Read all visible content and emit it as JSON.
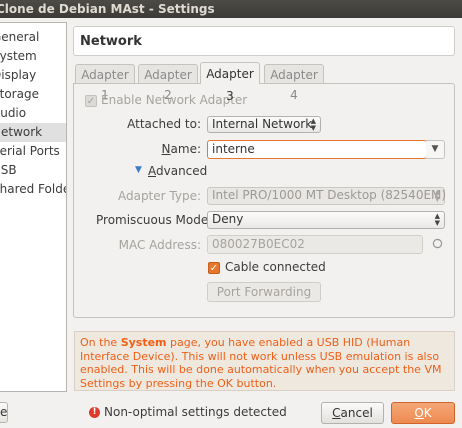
{
  "window": {
    "title": "Clone de Debian MAst - Settings"
  },
  "sidebar": {
    "items": [
      {
        "label": "General"
      },
      {
        "label": "System"
      },
      {
        "label": "Display"
      },
      {
        "label": "Storage"
      },
      {
        "label": "Audio"
      },
      {
        "label": "Network",
        "active": true
      },
      {
        "label": "Serial Ports"
      },
      {
        "label": "USB"
      },
      {
        "label": "Shared Folders"
      }
    ]
  },
  "page": {
    "title": "Network"
  },
  "tabs": [
    {
      "label": "Adapter 1"
    },
    {
      "label": "Adapter 2"
    },
    {
      "label": "Adapter 3",
      "active": true
    },
    {
      "label": "Adapter 4"
    }
  ],
  "adapter": {
    "enable_label": "Enable Network Adapter",
    "enable_checked": true,
    "attached_label": "Attached to:",
    "attached_value": "Internal Network",
    "name_label": "Name:",
    "name_value": "interne",
    "advanced_label": "Advanced",
    "adapter_type_label": "Adapter Type:",
    "adapter_type_value": "Intel PRO/1000 MT Desktop (82540EM)",
    "promiscuous_label": "Promiscuous Mode:",
    "promiscuous_value": "Deny",
    "mac_label": "MAC Address:",
    "mac_value": "080027B0EC02",
    "cable_label": "Cable connected",
    "cable_checked": true,
    "port_forwarding_label": "Port Forwarding"
  },
  "warning": {
    "prefix": "On the ",
    "bold": "System",
    "suffix": " page, you have enabled a USB HID (Human Interface Device). This will not work unless USB emulation is also enabled. This will be done automatically when you accept the VM Settings by pressing the OK button."
  },
  "footer": {
    "help_label": "Help",
    "status_text": "Non-optimal settings detected",
    "cancel_label": "Cancel",
    "ok_label": "OK"
  },
  "colors": {
    "accent": "#e8772d",
    "warning_text": "#ee5f17",
    "ok_button": "#ed8a51"
  }
}
